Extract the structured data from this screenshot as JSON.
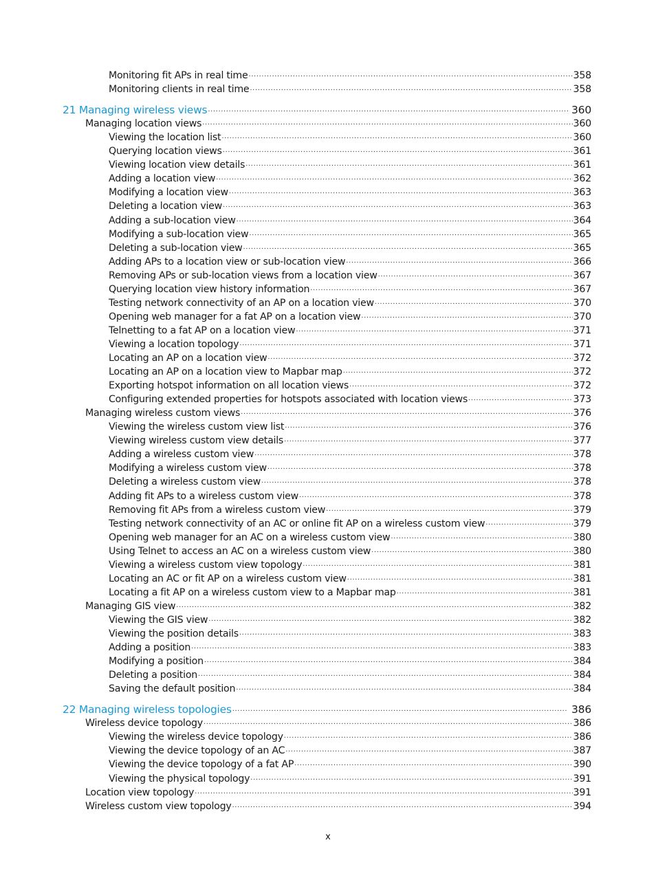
{
  "colors": {
    "accent": "#1a9ad6",
    "text": "#1a1a1a"
  },
  "toc": [
    {
      "level": 3,
      "title": "Monitoring fit APs in real time",
      "page": "358"
    },
    {
      "level": 3,
      "title": "Monitoring clients in real time",
      "page": "358"
    },
    {
      "level": 1,
      "title": "21 Managing wireless views",
      "page": "360"
    },
    {
      "level": 2,
      "title": "Managing location views",
      "page": "360"
    },
    {
      "level": 3,
      "title": "Viewing the location list",
      "page": "360"
    },
    {
      "level": 3,
      "title": "Querying location views",
      "page": "361"
    },
    {
      "level": 3,
      "title": "Viewing location view details",
      "page": "361"
    },
    {
      "level": 3,
      "title": "Adding a location view",
      "page": "362"
    },
    {
      "level": 3,
      "title": "Modifying a location view",
      "page": "363"
    },
    {
      "level": 3,
      "title": "Deleting a location view",
      "page": "363"
    },
    {
      "level": 3,
      "title": "Adding a sub-location view",
      "page": "364"
    },
    {
      "level": 3,
      "title": "Modifying a sub-location view",
      "page": "365"
    },
    {
      "level": 3,
      "title": "Deleting a sub-location view",
      "page": "365"
    },
    {
      "level": 3,
      "title": "Adding APs to a location view or sub-location view",
      "page": "366"
    },
    {
      "level": 3,
      "title": "Removing APs or sub-location views from a location view",
      "page": "367"
    },
    {
      "level": 3,
      "title": "Querying location view history information",
      "page": "367"
    },
    {
      "level": 3,
      "title": "Testing network connectivity of an AP on a location view",
      "page": "370"
    },
    {
      "level": 3,
      "title": "Opening web manager for a fat AP on a location view",
      "page": "370"
    },
    {
      "level": 3,
      "title": "Telnetting to a fat AP on a location view",
      "page": "371"
    },
    {
      "level": 3,
      "title": "Viewing a location topology",
      "page": "371"
    },
    {
      "level": 3,
      "title": "Locating an AP on a location view",
      "page": "372"
    },
    {
      "level": 3,
      "title": "Locating an AP on a location view to Mapbar map",
      "page": "372"
    },
    {
      "level": 3,
      "title": "Exporting hotspot information on all location views",
      "page": "372"
    },
    {
      "level": 3,
      "title": "Configuring extended properties for hotspots associated with location views",
      "page": "373"
    },
    {
      "level": 2,
      "title": "Managing wireless custom views",
      "page": "376"
    },
    {
      "level": 3,
      "title": "Viewing the wireless custom view list",
      "page": "376"
    },
    {
      "level": 3,
      "title": "Viewing wireless custom view details",
      "page": "377"
    },
    {
      "level": 3,
      "title": "Adding a wireless custom view",
      "page": "378"
    },
    {
      "level": 3,
      "title": "Modifying a wireless custom view",
      "page": "378"
    },
    {
      "level": 3,
      "title": "Deleting a wireless custom view",
      "page": "378"
    },
    {
      "level": 3,
      "title": "Adding fit APs to a wireless custom view",
      "page": "378"
    },
    {
      "level": 3,
      "title": "Removing fit APs from a wireless custom view",
      "page": "379"
    },
    {
      "level": 3,
      "title": "Testing network connectivity of an AC or online fit AP on a wireless custom view",
      "page": "379"
    },
    {
      "level": 3,
      "title": "Opening web manager for an AC on a wireless custom view",
      "page": "380"
    },
    {
      "level": 3,
      "title": "Using Telnet to access an AC on a wireless custom view",
      "page": "380"
    },
    {
      "level": 3,
      "title": "Viewing a wireless custom view topology",
      "page": "381"
    },
    {
      "level": 3,
      "title": "Locating an AC or fit AP on a wireless custom view",
      "page": "381"
    },
    {
      "level": 3,
      "title": "Locating a fit AP on a wireless custom view to a Mapbar map",
      "page": "381"
    },
    {
      "level": 2,
      "title": "Managing GIS view",
      "page": "382"
    },
    {
      "level": 3,
      "title": "Viewing the GIS view",
      "page": "382"
    },
    {
      "level": 3,
      "title": "Viewing the position details",
      "page": "383"
    },
    {
      "level": 3,
      "title": "Adding a position",
      "page": "383"
    },
    {
      "level": 3,
      "title": "Modifying a position",
      "page": "384"
    },
    {
      "level": 3,
      "title": "Deleting a position",
      "page": "384"
    },
    {
      "level": 3,
      "title": "Saving the default position",
      "page": "384"
    },
    {
      "level": 1,
      "title": "22 Managing wireless topologies",
      "page": "386"
    },
    {
      "level": 2,
      "title": "Wireless device topology",
      "page": "386"
    },
    {
      "level": 3,
      "title": "Viewing the wireless device topology",
      "page": "386"
    },
    {
      "level": 3,
      "title": "Viewing the device topology of an AC",
      "page": "387"
    },
    {
      "level": 3,
      "title": "Viewing the device topology of a fat AP",
      "page": "390"
    },
    {
      "level": 3,
      "title": "Viewing the physical topology",
      "page": "391"
    },
    {
      "level": 2,
      "title": "Location view topology",
      "page": "391"
    },
    {
      "level": 2,
      "title": "Wireless custom view topology",
      "page": "394"
    }
  ],
  "footer": {
    "page_number": "x"
  }
}
